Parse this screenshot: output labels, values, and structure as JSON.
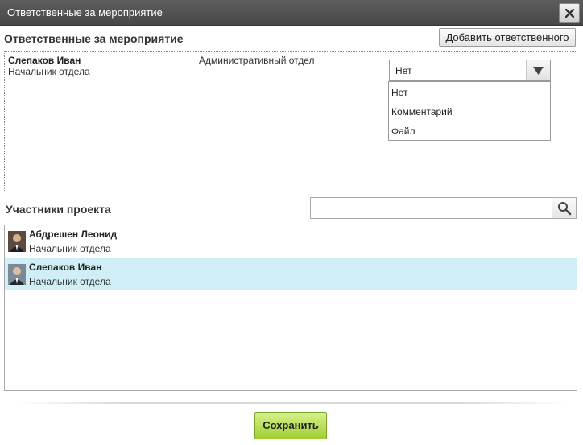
{
  "dialog": {
    "title": "Ответственные за мероприятие",
    "close_icon": "close-icon"
  },
  "responsible": {
    "section_title": "Ответственные за мероприятие",
    "add_button_label": "Добавить ответственного",
    "rows": [
      {
        "name": "Слепаков Иван",
        "position": "Начальник отдела",
        "department": "Административный отдел",
        "select_value": "Нет"
      }
    ],
    "dropdown_options": [
      "Нет",
      "Комментарий",
      "Файл"
    ]
  },
  "participants": {
    "section_title": "Участники проекта",
    "search_value": "",
    "search_icon": "search-icon",
    "items": [
      {
        "name": "Абдрешен Леонид",
        "position": "Начальник отдела",
        "selected": false
      },
      {
        "name": "Слепаков Иван",
        "position": "Начальник отдела",
        "selected": true
      }
    ]
  },
  "footer": {
    "save_label": "Сохранить"
  },
  "colors": {
    "titlebar": "#4f4f4f",
    "selected_row": "#cfeef5",
    "save_button": "#b5dd4f"
  }
}
